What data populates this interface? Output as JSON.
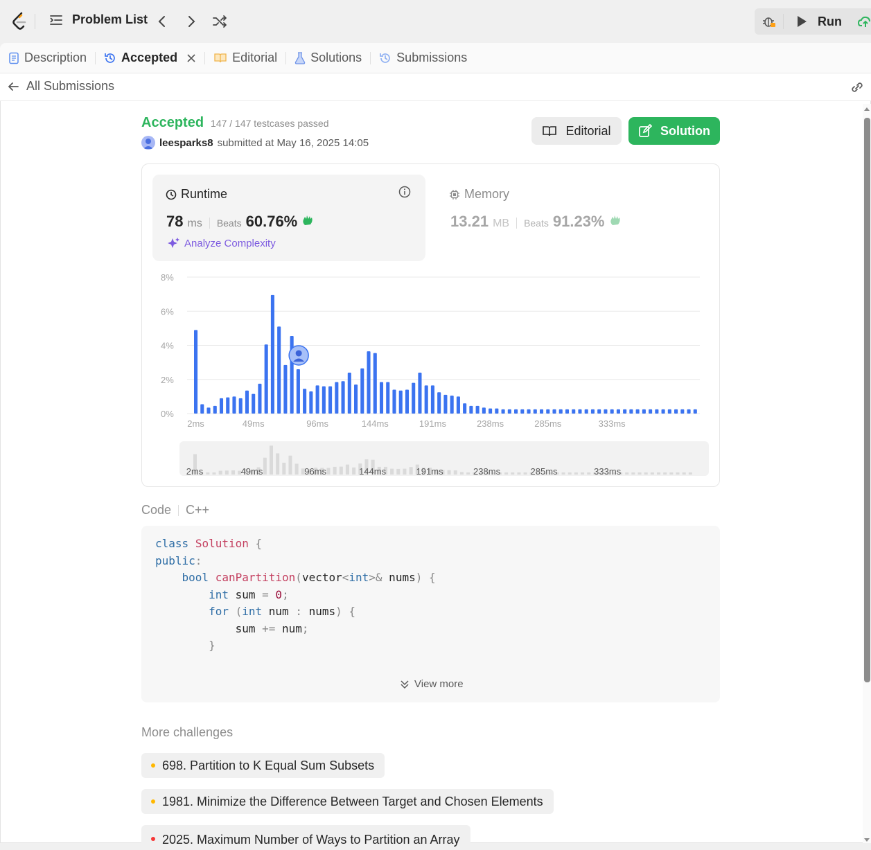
{
  "topbar": {
    "problem_list_label": "Problem List",
    "run_label": "Run"
  },
  "tabs": [
    {
      "label": "Description",
      "icon": "document-icon"
    },
    {
      "label": "Accepted",
      "icon": "history-icon"
    },
    {
      "label": "Editorial",
      "icon": "book-icon"
    },
    {
      "label": "Solutions",
      "icon": "flask-icon"
    },
    {
      "label": "Submissions",
      "icon": "history-icon"
    }
  ],
  "subbar": {
    "back_label": "All Submissions"
  },
  "result": {
    "status": "Accepted",
    "testcases": "147 / 147 testcases passed",
    "username": "leesparks8",
    "submitted_text": "submitted at May 16, 2025 14:05",
    "editorial_button": "Editorial",
    "solution_button": "Solution"
  },
  "runtime": {
    "label": "Runtime",
    "value": "78",
    "unit": "ms",
    "beats_label": "Beats",
    "beats_value": "60.76%",
    "analyze_label": "Analyze Complexity"
  },
  "memory": {
    "label": "Memory",
    "value": "13.21",
    "unit": "MB",
    "beats_label": "Beats",
    "beats_value": "91.23%"
  },
  "chart_data": {
    "type": "bar",
    "ylim": [
      0,
      8
    ],
    "y_ticks": [
      "0%",
      "2%",
      "4%",
      "6%",
      "8%"
    ],
    "x_ticks": [
      "2ms",
      "49ms",
      "96ms",
      "144ms",
      "191ms",
      "238ms",
      "285ms",
      "333ms"
    ],
    "values": [
      4.9,
      0.55,
      0.35,
      0.45,
      0.9,
      0.95,
      1.0,
      0.9,
      1.35,
      1.15,
      1.75,
      4.05,
      6.95,
      5.1,
      2.85,
      4.55,
      2.6,
      1.45,
      1.3,
      1.65,
      1.6,
      1.6,
      1.85,
      1.9,
      2.4,
      1.7,
      2.65,
      3.65,
      3.55,
      1.85,
      1.85,
      1.4,
      1.35,
      1.4,
      1.8,
      2.4,
      1.65,
      1.65,
      1.25,
      1.1,
      1.05,
      1.0,
      0.6,
      0.45,
      0.45,
      0.35,
      0.3,
      0.3,
      0.25,
      0.25,
      0.25,
      0.25,
      0.25,
      0.25,
      0.25,
      0.25,
      0.25,
      0.25,
      0.25,
      0.25,
      0.25,
      0.25,
      0.25,
      0.25,
      0.25,
      0.25,
      0.25,
      0.25,
      0.25,
      0.25,
      0.25,
      0.25,
      0.25,
      0.25,
      0.25,
      0.25,
      0.25,
      0.25,
      0.25
    ],
    "marker_index": 15,
    "bar_color": "#3b73f0"
  },
  "code": {
    "label": "Code",
    "language": "C++",
    "view_more": "View more"
  },
  "more": {
    "title": "More challenges",
    "items": [
      {
        "label": "698. Partition to K Equal Sum Subsets",
        "color": "#ffb800"
      },
      {
        "label": "1981. Minimize the Difference Between Target and Chosen Elements",
        "color": "#ffb800"
      },
      {
        "label": "2025. Maximum Number of Ways to Partition an Array",
        "color": "#f63737"
      }
    ]
  }
}
